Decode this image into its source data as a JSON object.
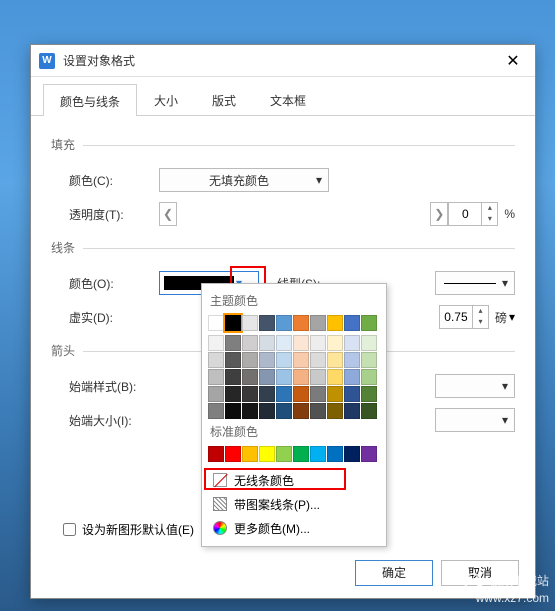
{
  "dialog": {
    "title": "设置对象格式"
  },
  "tabs": {
    "t0": "颜色与线条",
    "t1": "大小",
    "t2": "版式",
    "t3": "文本框"
  },
  "fill": {
    "section": "填充",
    "color_label": "颜色(C):",
    "color_value": "无填充颜色",
    "trans_label": "透明度(T):",
    "trans_value": "0",
    "trans_unit": "%"
  },
  "line": {
    "section": "线条",
    "color_label": "颜色(O):",
    "style_label": "线型(S):",
    "dash_label": "虚实(D):",
    "weight_value": "0.75",
    "weight_unit": "磅"
  },
  "arrow": {
    "section": "箭头",
    "begin_style_label": "始端样式(B):",
    "begin_size_label": "始端大小(I):"
  },
  "popup": {
    "theme_title": "主题颜色",
    "standard_title": "标准颜色",
    "no_line_color": "无线条颜色",
    "pattern_lines": "带图案线条(P)...",
    "more_colors": "更多颜色(M)...",
    "theme_row0": [
      "#ffffff",
      "#000000",
      "#e7e6e6",
      "#44546a",
      "#5b9bd5",
      "#ed7d31",
      "#a5a5a5",
      "#ffc000",
      "#4472c4",
      "#70ad47"
    ],
    "theme_shades": [
      [
        "#f2f2f2",
        "#7f7f7f",
        "#d0cece",
        "#d6dce4",
        "#deebf6",
        "#fbe5d5",
        "#ededed",
        "#fff2cc",
        "#d9e2f3",
        "#e2efd9"
      ],
      [
        "#d8d8d8",
        "#595959",
        "#aeabab",
        "#adb9ca",
        "#bdd7ee",
        "#f7cbac",
        "#dbdbdb",
        "#fee599",
        "#b4c6e7",
        "#c5e0b3"
      ],
      [
        "#bfbfbf",
        "#3f3f3f",
        "#757070",
        "#8496b0",
        "#9cc3e5",
        "#f4b183",
        "#c9c9c9",
        "#ffd965",
        "#8eaadb",
        "#a8d08d"
      ],
      [
        "#a5a5a5",
        "#262626",
        "#3a3838",
        "#323f4f",
        "#2e75b5",
        "#c55a11",
        "#7b7b7b",
        "#bf9000",
        "#2f5496",
        "#538135"
      ],
      [
        "#7f7f7f",
        "#0c0c0c",
        "#171616",
        "#222a35",
        "#1e4e79",
        "#833c0b",
        "#525252",
        "#7f6000",
        "#1f3864",
        "#375623"
      ]
    ],
    "standard": [
      "#c00000",
      "#ff0000",
      "#ffc000",
      "#ffff00",
      "#92d050",
      "#00b050",
      "#00b0f0",
      "#0070c0",
      "#002060",
      "#7030a0"
    ]
  },
  "checkbox": {
    "label": "设为新图形默认值(E)"
  },
  "buttons": {
    "ok": "确定",
    "cancel": "取消"
  },
  "watermark": {
    "brand": "极致下载站",
    "url": "www.xz7.com"
  }
}
